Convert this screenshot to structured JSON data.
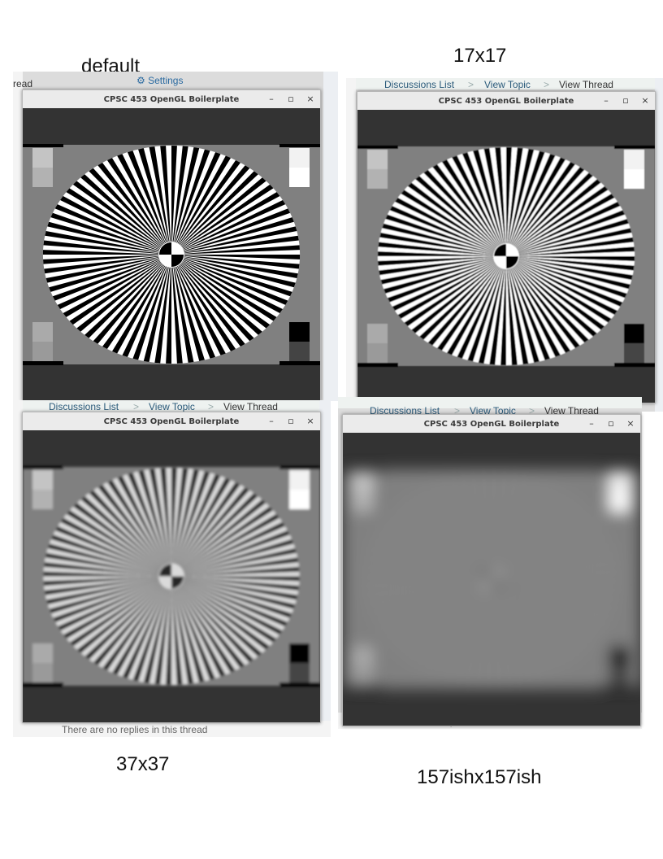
{
  "captions": {
    "default": "default",
    "c17": "17x17",
    "c37": "37x37",
    "c157": "157ishx157ish"
  },
  "window": {
    "title": "CPSC 453 OpenGL Boilerplate",
    "minimize_glyph": "–",
    "maximize_glyph": "▫",
    "close_glyph": "×"
  },
  "background": {
    "breadcrumb_discussions": "Discussions List",
    "breadcrumb_topic": "View Topic",
    "breadcrumb_thread": "View Thread",
    "breadcrumb_sep": ">",
    "no_replies": "There are no replies in this thread",
    "settings_label": "Settings",
    "left_fragment_read": "read"
  },
  "panels": [
    {
      "id": "default",
      "blur": 0
    },
    {
      "id": "17x17",
      "blur": 0.4
    },
    {
      "id": "37x37",
      "blur": 1.6
    },
    {
      "id": "157",
      "blur": 9
    }
  ],
  "colors": {
    "gl_background": "#333333",
    "target_gray": "#808080",
    "window_chrome": "#ebebeb",
    "link": "#2a5a7a"
  }
}
